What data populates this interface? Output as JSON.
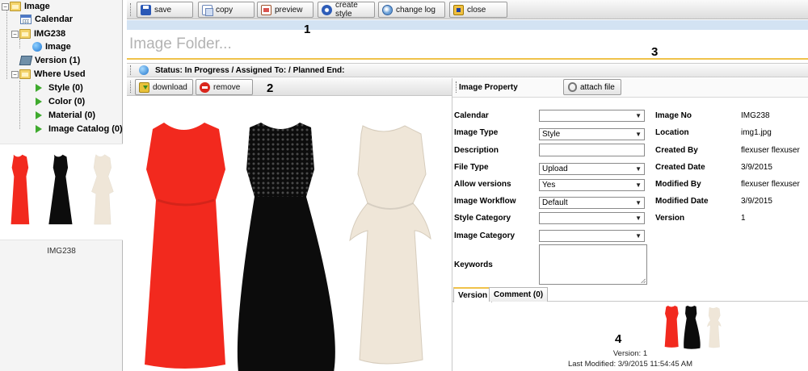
{
  "tree": {
    "items": [
      {
        "label": "Image",
        "icon": "folder-icon"
      },
      {
        "label": "Calendar",
        "icon": "calendar-icon"
      },
      {
        "label": "IMG238",
        "icon": "folder-icon"
      },
      {
        "label": "Image",
        "icon": "globe-icon"
      },
      {
        "label": "Version (1)",
        "icon": "layers-icon"
      },
      {
        "label": "Where Used",
        "icon": "folder-icon"
      },
      {
        "label": "Style (0)",
        "icon": "play-icon"
      },
      {
        "label": "Color (0)",
        "icon": "play-icon"
      },
      {
        "label": "Material (0)",
        "icon": "play-icon"
      },
      {
        "label": "Image Catalog (0)",
        "icon": "play-icon"
      }
    ],
    "thumbnail_caption": "IMG238"
  },
  "toolbar": {
    "save": "save",
    "copy": "copy",
    "preview": "preview",
    "create_style": "create style",
    "change_log": "change log",
    "close": "close"
  },
  "folder_title": "Image Folder...",
  "status": "Status: In Progress / Assigned To: / Planned End:",
  "image_toolbar": {
    "download": "download",
    "remove": "remove"
  },
  "dress_colors": {
    "red": "#f2291e",
    "black": "#0c0c0c",
    "cream": "#efe6d8"
  },
  "property": {
    "title": "Image Property",
    "attach_file": "attach file",
    "fields": [
      {
        "label": "Calendar",
        "value": "",
        "kind": "select"
      },
      {
        "label": "Image Type",
        "value": "Style",
        "kind": "select"
      },
      {
        "label": "Description",
        "value": "",
        "kind": "text"
      },
      {
        "label": "File Type",
        "value": "Upload",
        "kind": "select"
      },
      {
        "label": "Allow versions",
        "value": "Yes",
        "kind": "select"
      },
      {
        "label": "Image Workflow",
        "value": "Default",
        "kind": "select"
      },
      {
        "label": "Style Category",
        "value": "",
        "kind": "select"
      },
      {
        "label": "Image Category",
        "value": "",
        "kind": "select"
      }
    ],
    "keywords_label": "Keywords",
    "keywords_value": "",
    "meta": [
      {
        "label": "Image No",
        "value": "IMG238"
      },
      {
        "label": "Location",
        "value": "img1.jpg"
      },
      {
        "label": "Created By",
        "value": "flexuser flexuser"
      },
      {
        "label": "Created Date",
        "value": "3/9/2015"
      },
      {
        "label": "Modified By",
        "value": "flexuser flexuser"
      },
      {
        "label": "Modified Date",
        "value": "3/9/2015"
      },
      {
        "label": "Version",
        "value": "1"
      }
    ]
  },
  "tabs": [
    {
      "label": "Version",
      "active": true
    },
    {
      "label": "Comment (0)",
      "active": false
    }
  ],
  "version_info": {
    "version": "Version: 1",
    "last_modified": "Last Modified: 3/9/2015 11:54:45 AM"
  },
  "annotations": [
    "1",
    "2",
    "3",
    "4"
  ]
}
